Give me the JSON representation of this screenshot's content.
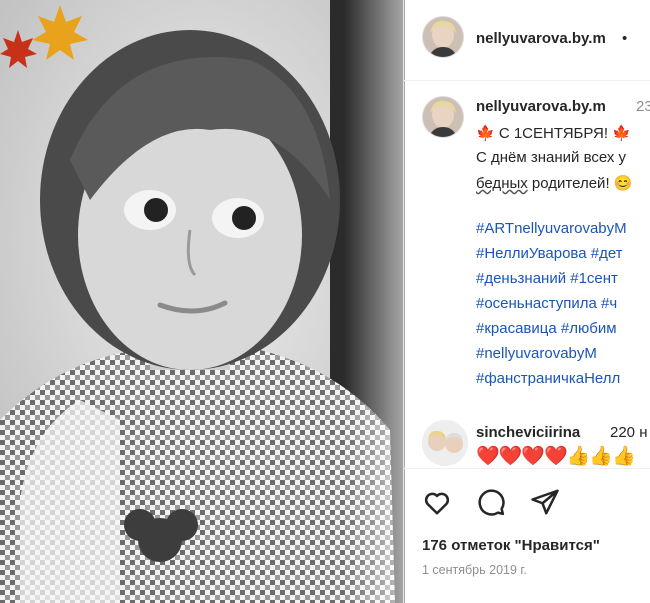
{
  "post": {
    "username": "nellyuvarova.by.m",
    "header_dot": "•",
    "caption": {
      "username": "nellyuvarova.by.m",
      "time": "23",
      "line1": "🍁 С 1СЕНТЯБРЯ! 🍁",
      "line2": "С днём знаний всех у",
      "line3_word": "бедных",
      "line3_rest": " родителей! 😊",
      "hashtags": [
        "#ARTnellyuvarovabyM",
        "#НеллиУварова #дет",
        "#деньзнаний #1сент",
        "#осеньнаступила #ч",
        "#красавица #любим",
        "#nellyuvarovabyM",
        "#фанстраничкаНелл"
      ]
    },
    "comment": {
      "username": "sincheviciirina",
      "time": "220 н",
      "emojis": "❤️❤️❤️❤️👍👍👍"
    },
    "likes": "176 отметок \"Нравится\"",
    "date": "1 сентябрь 2019 г."
  },
  "icons": {
    "like": "heart-icon",
    "comment": "comment-icon",
    "share": "share-icon",
    "leaves": "maple-leaf-icon"
  },
  "colors": {
    "hashtag": "#1a56b7",
    "text": "#262626",
    "secondary": "#8e8e8e"
  }
}
